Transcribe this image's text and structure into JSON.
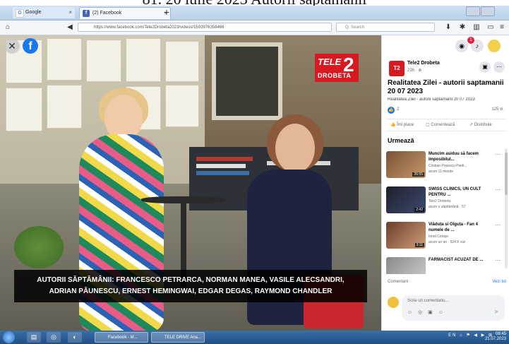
{
  "document_caption": "81. 20 iulie 2023 Autorii săptămânii",
  "browser": {
    "tabs": [
      {
        "label": "Google",
        "favicon": "G"
      },
      {
        "label": "(2) Facebook",
        "favicon": "f"
      }
    ],
    "new_tab": "+",
    "url": "https://www.facebook.com/Tele2Drobeta2023/videos/1593976358466",
    "search_placeholder": "Q. Search"
  },
  "video": {
    "channel_logo_top": "TELE",
    "channel_logo_num": "2",
    "channel_logo_bottom": "DROBETA",
    "lower_third_line1": "AUTORII SĂPTĂMÂNII: FRANCESCO PETRARCA, NORMAN MANEA, VASILE ALECSANDRI,",
    "lower_third_line2": "ADRIAN PĂUNESCU, ERNEST HEMINGWAI, EDGAR DEGAS, RAYMOND CHANDLER"
  },
  "sidebar": {
    "page_name": "Tele2 Drobeta",
    "page_meta": "23h · ⊕",
    "post_title": "Realitatea Zilei - autorii saptamanii 20 07 2023",
    "post_desc": "Realitatea Zilei - autorii saptamanii 20 07 2023",
    "reactions_count": "2",
    "views": "125 vi.",
    "actions": [
      "Îmi place",
      "Comentează",
      "Distribuie"
    ],
    "next_heading": "Urmează",
    "next_items": [
      {
        "title": "Muncim asiduu să facem împosibilul...",
        "source": "Cristian Popescu Piedi...",
        "meta": "acum 11 minute",
        "duration": "26:55"
      },
      {
        "title": "SWISS CLINICS, UN CULT PENTRU ...",
        "source": "Tele2 Drobeta",
        "meta": "acum o săptămână · 57",
        "duration": "2:42"
      },
      {
        "title": "Viâduța și Olguța - Fan 4 numele de ...",
        "source": "Ionel Cetașe",
        "meta": "acum un an · 524 K vizi",
        "duration": "3:11"
      },
      {
        "title": "FARMACIST ACUZAT DE ...",
        "source": "",
        "meta": "",
        "duration": ""
      }
    ],
    "comments_label": "Comentarii",
    "view_all": "Vezi tot",
    "comment_placeholder": "Scrie un comentariu...",
    "comment_tools": "☺ ◎ ▣ ☺",
    "send": "➤"
  },
  "taskbar": {
    "tasks": [
      "Facebook - M...",
      "TELE DRIVE Ana..."
    ],
    "tray": "EN ⌂ ⚑ ◀ ▶ ⊞",
    "time": "08:45",
    "date": "21.07.2023"
  },
  "colors": {
    "facebook_blue": "#1877f2",
    "channel_red": "#d71920",
    "notification_red": "#e41e3f",
    "taskbar_blue": "#1f4f86"
  },
  "icons": [
    "close-icon",
    "facebook-icon",
    "messenger-icon",
    "bell-icon",
    "avatar-icon",
    "more-icon",
    "like-icon",
    "comment-icon",
    "share-icon",
    "send-icon"
  ]
}
